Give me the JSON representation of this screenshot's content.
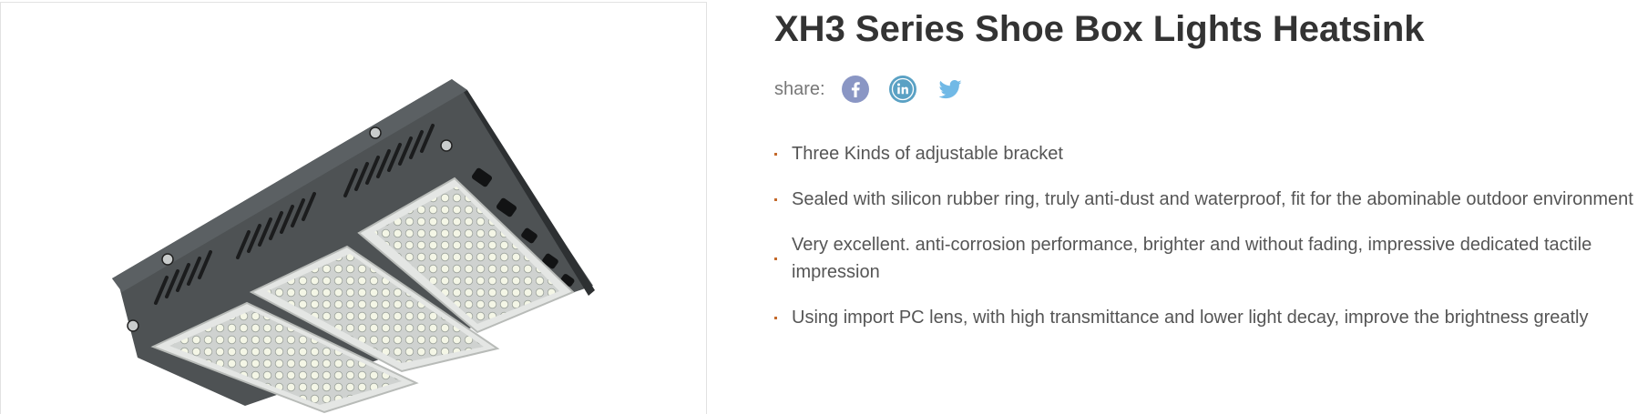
{
  "product": {
    "title": "XH3 Series Shoe Box Lights Heatsink"
  },
  "share": {
    "label": "share:",
    "networks": [
      {
        "name": "facebook",
        "icon": "facebook-icon",
        "color": "#8a96c4"
      },
      {
        "name": "linkedin",
        "icon": "linkedin-icon",
        "color": "#5aa1c4"
      },
      {
        "name": "twitter",
        "icon": "twitter-icon",
        "color": "#71b9e6"
      }
    ]
  },
  "features": [
    "Three Kinds of adjustable bracket",
    "Sealed with silicon rubber ring, truly anti-dust and waterproof, fit for the abominable outdoor environment",
    "Very excellent. anti-corrosion performance, brighter and without fading, impressive dedicated tactile impression",
    "Using import PC lens, with high transmittance and lower light decay, improve the brightness greatly"
  ],
  "colors": {
    "title": "#333333",
    "text": "#555555",
    "bullet": "#c46a2b",
    "panel_border": "#e2e2e2"
  }
}
